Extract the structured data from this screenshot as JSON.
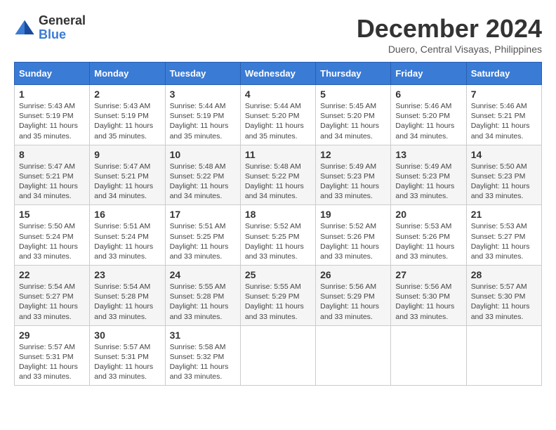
{
  "header": {
    "logo_general": "General",
    "logo_blue": "Blue",
    "month_title": "December 2024",
    "location": "Duero, Central Visayas, Philippines"
  },
  "days_of_week": [
    "Sunday",
    "Monday",
    "Tuesday",
    "Wednesday",
    "Thursday",
    "Friday",
    "Saturday"
  ],
  "weeks": [
    [
      {
        "day": "1",
        "sunrise": "5:43 AM",
        "sunset": "5:19 PM",
        "daylight": "11 hours and 35 minutes."
      },
      {
        "day": "2",
        "sunrise": "5:43 AM",
        "sunset": "5:19 PM",
        "daylight": "11 hours and 35 minutes."
      },
      {
        "day": "3",
        "sunrise": "5:44 AM",
        "sunset": "5:19 PM",
        "daylight": "11 hours and 35 minutes."
      },
      {
        "day": "4",
        "sunrise": "5:44 AM",
        "sunset": "5:20 PM",
        "daylight": "11 hours and 35 minutes."
      },
      {
        "day": "5",
        "sunrise": "5:45 AM",
        "sunset": "5:20 PM",
        "daylight": "11 hours and 34 minutes."
      },
      {
        "day": "6",
        "sunrise": "5:46 AM",
        "sunset": "5:20 PM",
        "daylight": "11 hours and 34 minutes."
      },
      {
        "day": "7",
        "sunrise": "5:46 AM",
        "sunset": "5:21 PM",
        "daylight": "11 hours and 34 minutes."
      }
    ],
    [
      {
        "day": "8",
        "sunrise": "5:47 AM",
        "sunset": "5:21 PM",
        "daylight": "11 hours and 34 minutes."
      },
      {
        "day": "9",
        "sunrise": "5:47 AM",
        "sunset": "5:21 PM",
        "daylight": "11 hours and 34 minutes."
      },
      {
        "day": "10",
        "sunrise": "5:48 AM",
        "sunset": "5:22 PM",
        "daylight": "11 hours and 34 minutes."
      },
      {
        "day": "11",
        "sunrise": "5:48 AM",
        "sunset": "5:22 PM",
        "daylight": "11 hours and 34 minutes."
      },
      {
        "day": "12",
        "sunrise": "5:49 AM",
        "sunset": "5:23 PM",
        "daylight": "11 hours and 33 minutes."
      },
      {
        "day": "13",
        "sunrise": "5:49 AM",
        "sunset": "5:23 PM",
        "daylight": "11 hours and 33 minutes."
      },
      {
        "day": "14",
        "sunrise": "5:50 AM",
        "sunset": "5:23 PM",
        "daylight": "11 hours and 33 minutes."
      }
    ],
    [
      {
        "day": "15",
        "sunrise": "5:50 AM",
        "sunset": "5:24 PM",
        "daylight": "11 hours and 33 minutes."
      },
      {
        "day": "16",
        "sunrise": "5:51 AM",
        "sunset": "5:24 PM",
        "daylight": "11 hours and 33 minutes."
      },
      {
        "day": "17",
        "sunrise": "5:51 AM",
        "sunset": "5:25 PM",
        "daylight": "11 hours and 33 minutes."
      },
      {
        "day": "18",
        "sunrise": "5:52 AM",
        "sunset": "5:25 PM",
        "daylight": "11 hours and 33 minutes."
      },
      {
        "day": "19",
        "sunrise": "5:52 AM",
        "sunset": "5:26 PM",
        "daylight": "11 hours and 33 minutes."
      },
      {
        "day": "20",
        "sunrise": "5:53 AM",
        "sunset": "5:26 PM",
        "daylight": "11 hours and 33 minutes."
      },
      {
        "day": "21",
        "sunrise": "5:53 AM",
        "sunset": "5:27 PM",
        "daylight": "11 hours and 33 minutes."
      }
    ],
    [
      {
        "day": "22",
        "sunrise": "5:54 AM",
        "sunset": "5:27 PM",
        "daylight": "11 hours and 33 minutes."
      },
      {
        "day": "23",
        "sunrise": "5:54 AM",
        "sunset": "5:28 PM",
        "daylight": "11 hours and 33 minutes."
      },
      {
        "day": "24",
        "sunrise": "5:55 AM",
        "sunset": "5:28 PM",
        "daylight": "11 hours and 33 minutes."
      },
      {
        "day": "25",
        "sunrise": "5:55 AM",
        "sunset": "5:29 PM",
        "daylight": "11 hours and 33 minutes."
      },
      {
        "day": "26",
        "sunrise": "5:56 AM",
        "sunset": "5:29 PM",
        "daylight": "11 hours and 33 minutes."
      },
      {
        "day": "27",
        "sunrise": "5:56 AM",
        "sunset": "5:30 PM",
        "daylight": "11 hours and 33 minutes."
      },
      {
        "day": "28",
        "sunrise": "5:57 AM",
        "sunset": "5:30 PM",
        "daylight": "11 hours and 33 minutes."
      }
    ],
    [
      {
        "day": "29",
        "sunrise": "5:57 AM",
        "sunset": "5:31 PM",
        "daylight": "11 hours and 33 minutes."
      },
      {
        "day": "30",
        "sunrise": "5:57 AM",
        "sunset": "5:31 PM",
        "daylight": "11 hours and 33 minutes."
      },
      {
        "day": "31",
        "sunrise": "5:58 AM",
        "sunset": "5:32 PM",
        "daylight": "11 hours and 33 minutes."
      },
      null,
      null,
      null,
      null
    ]
  ],
  "labels": {
    "sunrise_prefix": "Sunrise: ",
    "sunset_prefix": "Sunset: ",
    "daylight_prefix": "Daylight: "
  }
}
